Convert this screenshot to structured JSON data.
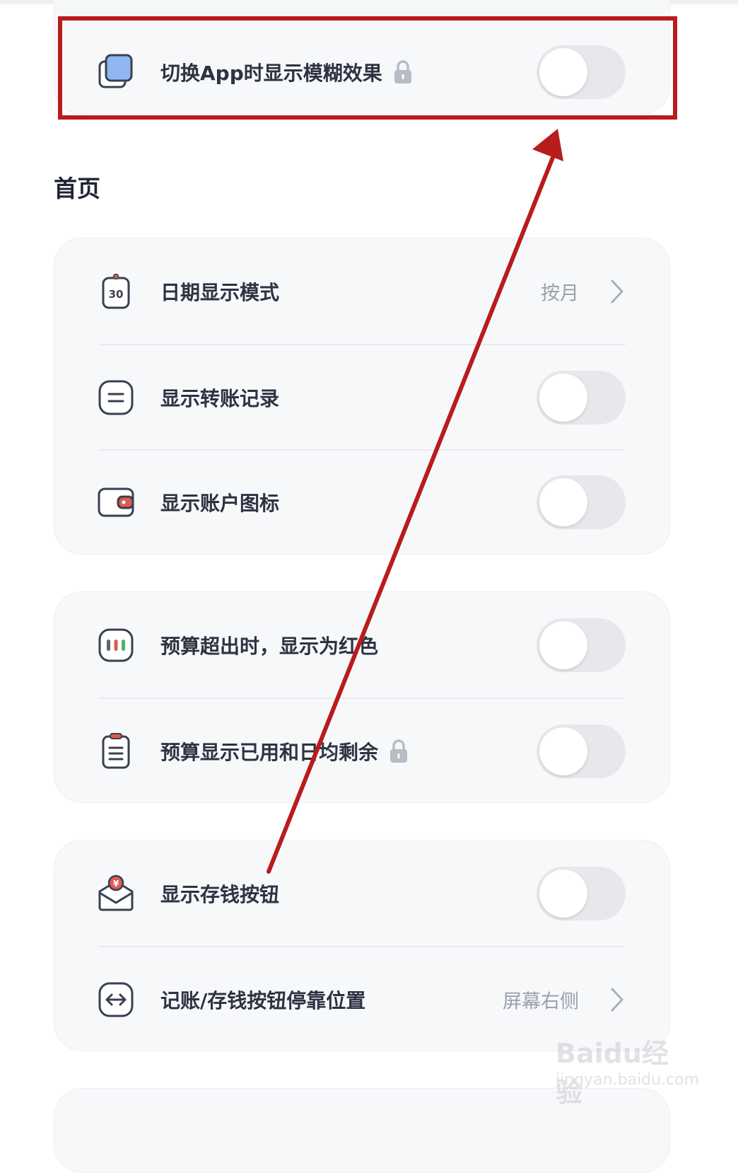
{
  "top_card": {
    "rows": [
      {
        "label": "切换App时显示模糊效果",
        "icon": "blur-layers-icon",
        "locked": true,
        "toggle": "off"
      }
    ]
  },
  "home_section": {
    "title": "首页",
    "group1": {
      "rows": [
        {
          "label": "日期显示模式",
          "icon": "calendar-30-icon",
          "value": "按月"
        },
        {
          "label": "显示转账记录",
          "icon": "transfer-icon",
          "toggle": "off"
        },
        {
          "label": "显示账户图标",
          "icon": "wallet-icon",
          "toggle": "off"
        }
      ]
    },
    "group2": {
      "rows": [
        {
          "label": "预算超出时，显示为红色",
          "icon": "budget-bars-icon",
          "toggle": "off"
        },
        {
          "label": "预算显示已用和日均剩余",
          "icon": "clipboard-icon",
          "locked": true,
          "toggle": "off"
        }
      ]
    },
    "group3": {
      "rows": [
        {
          "label": "显示存钱按钮",
          "icon": "savings-envelope-icon",
          "toggle": "off"
        },
        {
          "label": "记账/存钱按钮停靠位置",
          "icon": "left-right-arrow-icon",
          "value": "屏幕右侧"
        }
      ]
    }
  },
  "colors": {
    "annotation": "#b81c1c",
    "card_bg": "#f7f8fa",
    "toggle_off": "#e7e8eb",
    "accent_blue": "#8fb6f2",
    "accent_red": "#e05a4f"
  },
  "watermark": {
    "main": "Baidu经验",
    "sub": "jingyan.baidu.com"
  }
}
